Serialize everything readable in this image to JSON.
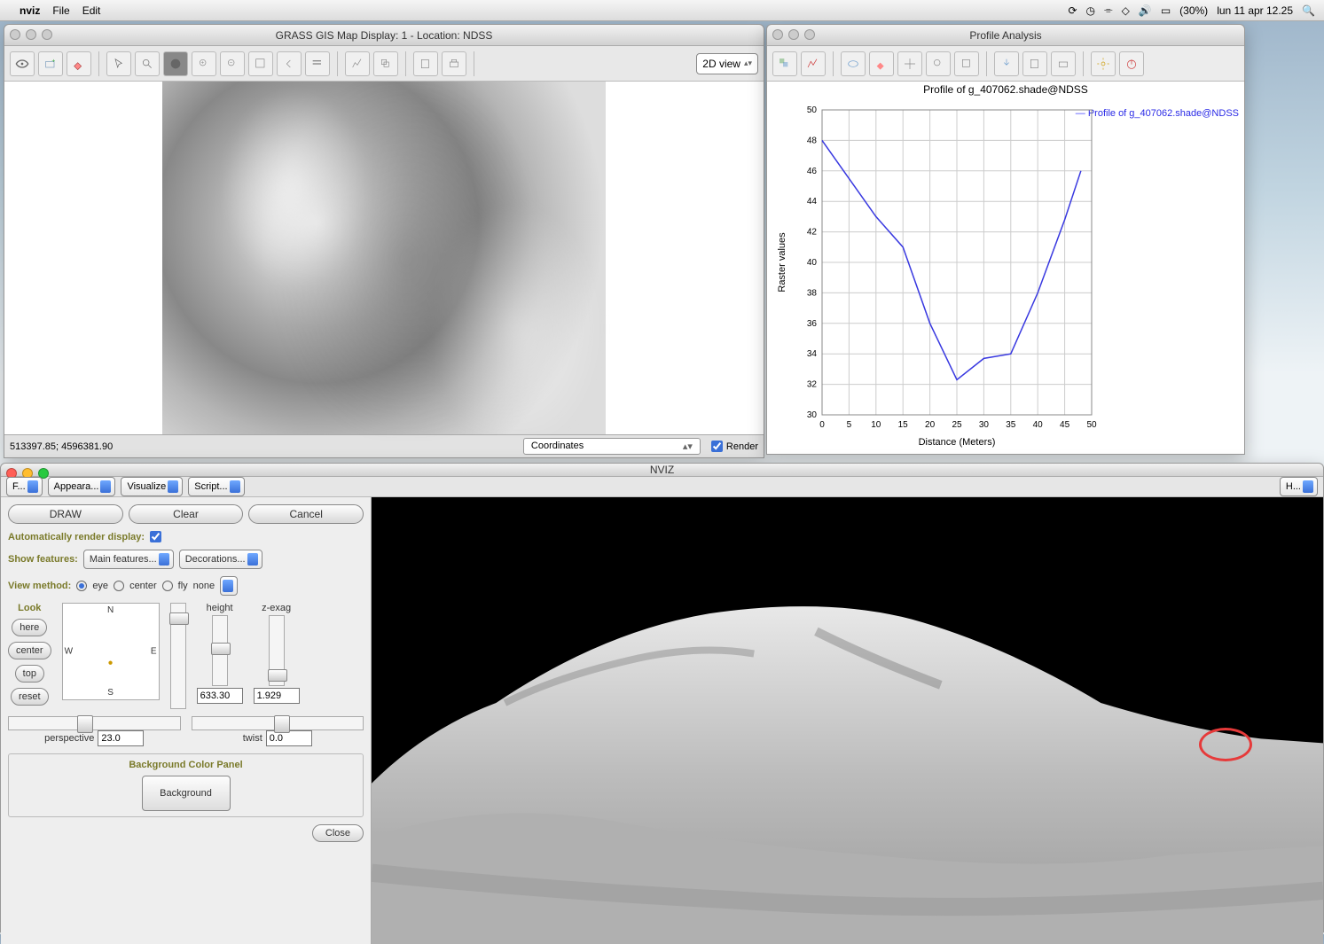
{
  "menubar": {
    "app": "nviz",
    "items": [
      "File",
      "Edit"
    ],
    "battery": "(30%)",
    "clock": "lun 11 apr 12.25",
    "icons": [
      "sync-icon",
      "clock-icon",
      "bluetooth-icon",
      "wifi-icon",
      "volume-icon",
      "battery-icon",
      "search-icon"
    ]
  },
  "map_display": {
    "title": "GRASS GIS Map Display: 1  - Location: NDSS",
    "view_mode": "2D view",
    "status_coords": "513397.85; 4596381.90",
    "status_select": "Coordinates",
    "render_label": "Render",
    "render_checked": true
  },
  "profile": {
    "title": "Profile Analysis",
    "legend": "Profile of g_407062.shade@NDSS"
  },
  "chart_data": {
    "type": "line",
    "title": "Profile of g_407062.shade@NDSS",
    "xlabel": "Distance (Meters)",
    "ylabel": "Raster values",
    "xlim": [
      0,
      50
    ],
    "ylim": [
      30,
      50
    ],
    "x": [
      0,
      5,
      10,
      15,
      20,
      25,
      30,
      35,
      40,
      45,
      48
    ],
    "values": [
      48,
      45.5,
      43,
      41,
      36,
      32.3,
      33.7,
      34,
      38,
      42.8,
      46
    ],
    "xticks": [
      0,
      5,
      10,
      15,
      20,
      25,
      30,
      35,
      40,
      45,
      50
    ],
    "yticks": [
      30,
      32,
      34,
      36,
      38,
      40,
      42,
      44,
      46,
      48,
      50
    ]
  },
  "nviz": {
    "title": "NVIZ",
    "tabs": {
      "f": "F...",
      "appear": "Appeara...",
      "visualize": "Visualize",
      "script": "Script...",
      "h": "H..."
    },
    "buttons": {
      "draw": "DRAW",
      "clear": "Clear",
      "cancel": "Cancel",
      "close": "Close"
    },
    "auto_render_label": "Automatically render display:",
    "auto_render": true,
    "show_features_label": "Show features:",
    "main_features": "Main features...",
    "decorations": "Decorations...",
    "view_method_label": "View method:",
    "view_methods": {
      "eye": "eye",
      "center": "center",
      "fly": "fly",
      "none": "none"
    },
    "view_selected": "eye",
    "look_label": "Look",
    "look_buttons": [
      "here",
      "center",
      "top",
      "reset"
    ],
    "compass": {
      "n": "N",
      "s": "S",
      "e": "E",
      "w": "W"
    },
    "height_label": "height",
    "height_value": "633.30",
    "zexag_label": "z-exag",
    "zexag_value": "1.929",
    "perspective_label": "perspective",
    "perspective_value": "23.0",
    "twist_label": "twist",
    "twist_value": "0.0",
    "bg_panel_label": "Background Color Panel",
    "bg_button": "Background"
  }
}
